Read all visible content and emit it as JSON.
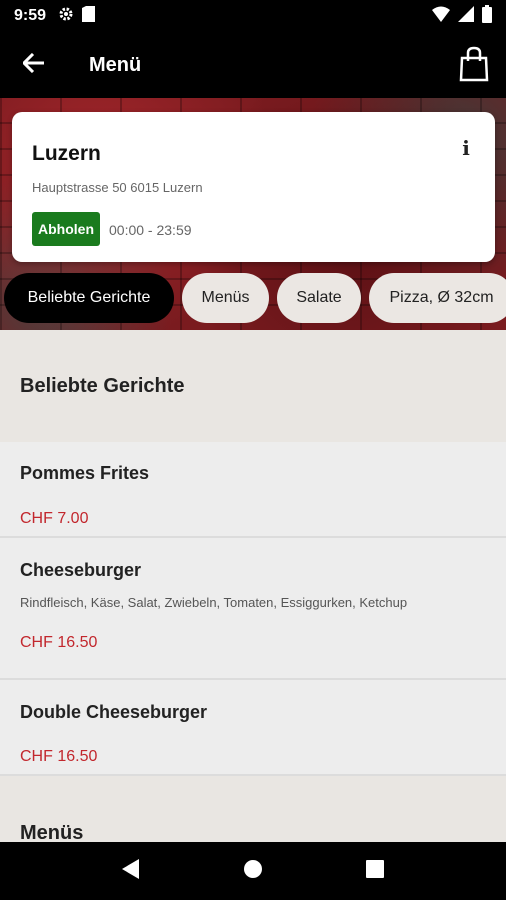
{
  "status_bar": {
    "time": "9:59"
  },
  "app_bar": {
    "title": "Menü"
  },
  "store": {
    "name": "Luzern",
    "address": "Hauptstrasse 50 6015 Luzern",
    "badge": "Abholen",
    "hours": "00:00 - 23:59",
    "info_glyph": "i"
  },
  "categories": [
    {
      "label": "Beliebte Gerichte",
      "active": true
    },
    {
      "label": "Menüs",
      "active": false
    },
    {
      "label": "Salate",
      "active": false
    },
    {
      "label": "Pizza, Ø 32cm",
      "active": false
    }
  ],
  "sections": [
    {
      "title": "Beliebte Gerichte",
      "items": [
        {
          "name": "Pommes Frites",
          "description": "",
          "price": "CHF 7.00"
        },
        {
          "name": "Cheeseburger",
          "description": "Rindfleisch, Käse, Salat, Zwiebeln, Tomaten, Essiggurken, Ketchup",
          "price": "CHF 16.50"
        },
        {
          "name": "Double Cheeseburger",
          "description": "",
          "price": "CHF 16.50"
        }
      ]
    },
    {
      "title": "Menüs"
    }
  ],
  "colors": {
    "accent_price": "#c2272d",
    "badge_green": "#1a7b1e"
  },
  "icons": [
    "back-arrow-icon",
    "shopping-bag-icon",
    "info-icon",
    "settings-icon",
    "sim-icon",
    "wifi-icon",
    "signal-icon",
    "battery-icon",
    "nav-back-icon",
    "nav-home-icon",
    "nav-recents-icon"
  ]
}
